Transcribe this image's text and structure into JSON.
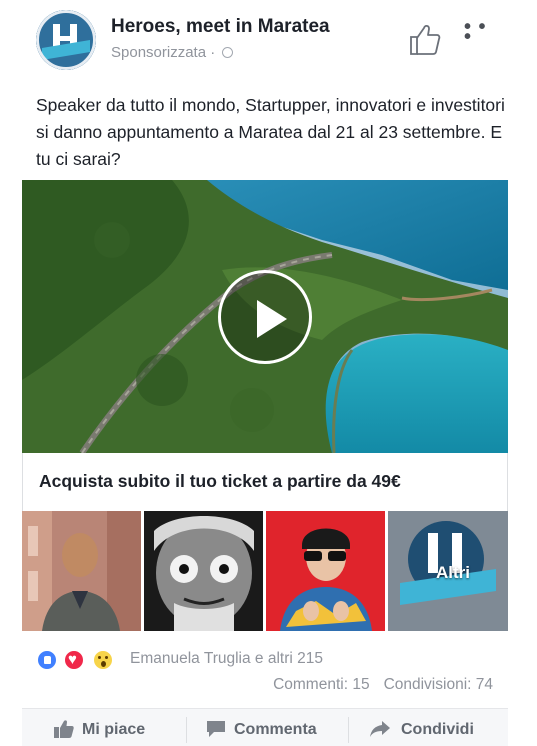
{
  "page": {
    "name": "Heroes, meet in Maratea",
    "sponsored_label": "Sponsorizzata",
    "separator": " · "
  },
  "post": {
    "text": "Speaker da tutto il mondo, Startupper, innovatori e investitori si danno appuntamento a Maratea dal 21 al 23 settembre. E tu ci sarai?"
  },
  "link": {
    "headline": "Acquista subito il tuo ticket a partire da 49€"
  },
  "thumbnails": {
    "more_label": "Altri"
  },
  "engagement": {
    "reactions_text": "Emanuela Truglia e altri 215",
    "comments": "Commenti: 15",
    "shares": "Condivisioni: 74"
  },
  "actions": {
    "like": "Mi piace",
    "comment": "Commenta",
    "share": "Condividi"
  },
  "icons": {
    "avatar": "heroes-logo",
    "like_page": "thumbs-up-outline-icon",
    "more": "more-dots-icon",
    "privacy": "globe-icon",
    "play": "play-icon",
    "reaction_like": "like-reaction-icon",
    "reaction_love": "love-reaction-icon",
    "reaction_wow": "wow-reaction-icon"
  },
  "colors": {
    "brand_blue": "#2f6f9c",
    "like_blue": "#4080ff",
    "love_red": "#f0284a",
    "meta_gray": "#90949c",
    "text": "#1d2129"
  }
}
